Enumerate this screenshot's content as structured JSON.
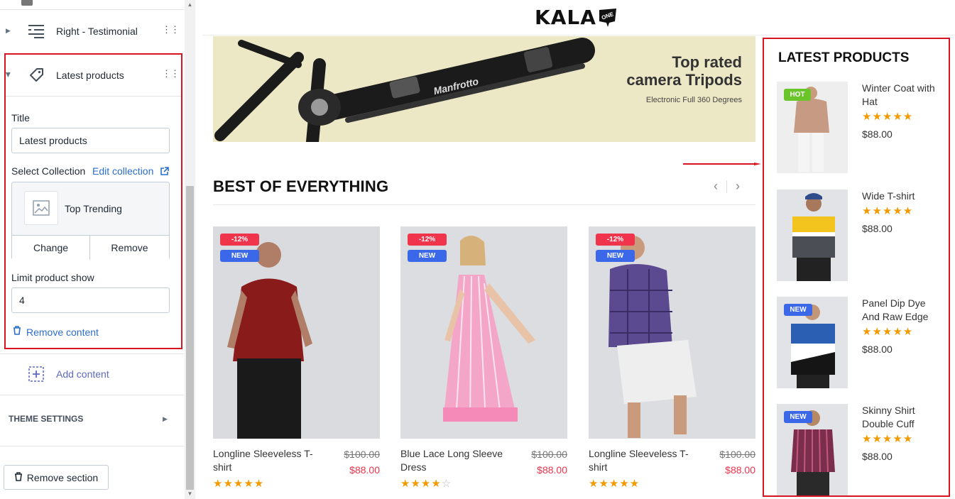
{
  "editor": {
    "top_item": {
      "label": "Right - Testimonial"
    },
    "latest_item": {
      "label": "Latest products"
    },
    "title_label": "Title",
    "title_value": "Latest products",
    "collection_label": "Select Collection",
    "edit_collection": "Edit collection",
    "collection_name": "Top Trending",
    "change_button": "Change",
    "remove_button": "Remove",
    "limit_label": "Limit product show",
    "limit_value": "4",
    "remove_content": "Remove content",
    "add_content": "Add content",
    "theme_settings": "THEME SETTINGS",
    "remove_section": "Remove section"
  },
  "preview": {
    "logo": "KALA",
    "logo_badge": "ONE",
    "banner": {
      "brand": "Manfrotto",
      "title_line1": "Top rated",
      "title_line2": "camera Tripods",
      "subtitle": "Electronic Full 360 Degrees"
    },
    "section_title": "BEST OF EVERYTHING",
    "products": [
      {
        "name": "Longline Sleeveless T-shirt",
        "old_price": "$100.00",
        "price": "$88.00",
        "badges": [
          "-12%",
          "NEW"
        ],
        "rating": 5
      },
      {
        "name": "Blue Lace Long Sleeve Dress",
        "old_price": "$100.00",
        "price": "$88.00",
        "badges": [
          "-12%",
          "NEW"
        ],
        "rating": 4
      },
      {
        "name": "Longline Sleeveless T-shirt",
        "old_price": "$100.00",
        "price": "$88.00",
        "badges": [
          "-12%",
          "NEW"
        ],
        "rating": 5
      }
    ],
    "latest": {
      "title": "LATEST PRODUCTS",
      "items": [
        {
          "name": "Winter Coat with Hat",
          "price": "$88.00",
          "badge": "HOT",
          "rating": 5
        },
        {
          "name": "Wide T-shirt",
          "price": "$88.00",
          "badge": "",
          "rating": 5
        },
        {
          "name": "Panel Dip Dye And Raw Edge",
          "price": "$88.00",
          "badge": "NEW",
          "rating": 5
        },
        {
          "name": "Skinny Shirt Double Cuff",
          "price": "$88.00",
          "badge": "NEW",
          "rating": 5
        }
      ]
    }
  },
  "colors": {
    "accent_red": "#d7141f",
    "link_blue": "#2c6ecb",
    "star": "#f29a00",
    "sale": "#f0344c",
    "new_badge": "#3b68e8",
    "hot_badge": "#6ac52b"
  }
}
